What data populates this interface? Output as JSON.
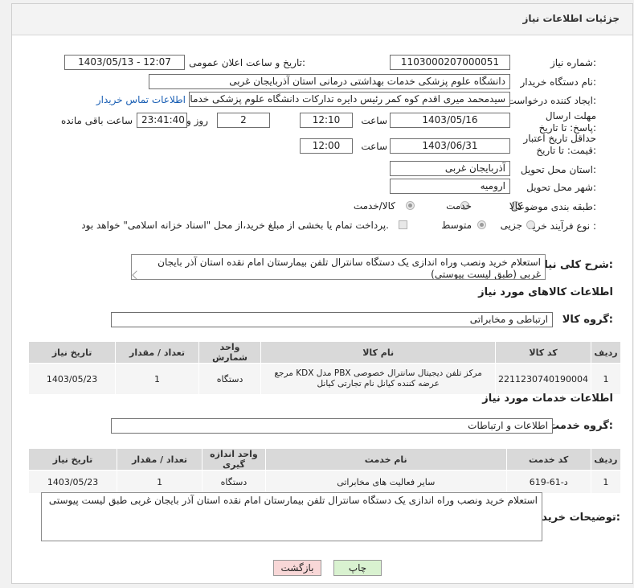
{
  "header": {
    "title": "جزئیات اطلاعات نیاز"
  },
  "form": {
    "need_number_label": "شماره نیاز:",
    "need_number": "1103000207000051",
    "announce_label": "تاریخ و ساعت اعلان عمومی:",
    "announce_value": "1403/05/13 - 12:07",
    "buyer_org_label": "نام دستگاه خریدار:",
    "buyer_org": "دانشگاه علوم پزشکی خدمات بهداشتی درمانی استان آذربایجان غربی",
    "creator_label": "ایجاد کننده درخواست:",
    "creator": "سیدمحمد میری اقدم کوه کمر رئیس دایره تدارکات دانشگاه علوم پزشکی خدمات",
    "contact_link": "اطلاعات تماس خریدار",
    "deadline_label": "مهلت ارسال پاسخ: تا تاریخ:",
    "deadline_date": "1403/05/16",
    "time_label": "ساعت",
    "deadline_time": "12:10",
    "days_value": "2",
    "days_label": "روز و",
    "remaining_time": "23:41:40",
    "remaining_label": "ساعت باقی مانده",
    "validity_label": "حداقل تاریخ اعتبار قیمت: تا تاریخ:",
    "validity_date": "1403/06/31",
    "validity_time": "12:00",
    "province_label": "استان محل تحویل:",
    "province": "آذربایجان غربی",
    "city_label": "شهر محل تحویل:",
    "city": "ارومیه",
    "category_label": "طبقه بندی موضوعی:",
    "category_options": [
      "کالا",
      "خدمت",
      "کالا/خدمت"
    ],
    "category_selected": "کالا/خدمت",
    "process_label": "نوع فرآیند خرید :",
    "process_options": [
      "جزیی",
      "متوسط"
    ],
    "process_note": "پرداخت تمام یا بخشی از مبلغ خرید،از محل \"اسناد خزانه اسلامی\" خواهد بود."
  },
  "description": {
    "label": "شرح کلی نیاز:",
    "text": "استعلام خرید ونصب وراه اندازی  یک دستگاه سانترال تلفن بیمارستان امام نقده استان آذر بایجان غربی (طبق لیست پیوستی)"
  },
  "goods": {
    "section_title": "اطلاعات کالاهای مورد نیاز",
    "group_label": "گروه کالا:",
    "group_value": "ارتباطی و مخابراتی",
    "columns": [
      "ردیف",
      "کد کالا",
      "نام کالا",
      "واحد شمارش",
      "تعداد / مقدار",
      "تاریخ نیاز"
    ],
    "rows": [
      [
        "1",
        "2211230740190004",
        "مرکز تلفن دیجیتال سانترال خصوصی PBX مدل KDX مرجع عرضه کننده کیانل نام تجارتی کیانل",
        "دستگاه",
        "1",
        "1403/05/23"
      ]
    ]
  },
  "services": {
    "section_title": "اطلاعات خدمات مورد نیاز",
    "group_label": "گروه خدمت:",
    "group_value": "اطلاعات و ارتباطات",
    "columns": [
      "ردیف",
      "کد خدمت",
      "نام خدمت",
      "واحد اندازه گیری",
      "تعداد / مقدار",
      "تاریخ نیاز"
    ],
    "rows": [
      [
        "1",
        "د-61-619",
        "سایر فعالیت های مخابراتی",
        "دستگاه",
        "1",
        "1403/05/23"
      ]
    ]
  },
  "buyer_notes": {
    "label": "توضیحات خریدار:",
    "text": "استعلام خرید ونصب وراه اندازی  یک دستگاه سانترال تلفن بیمارستان امام نقده استان آذر بایجان غربی طبق لیست پیوستی"
  },
  "buttons": {
    "print": "چاپ",
    "back": "بازگشت"
  },
  "colors": {
    "back_button": "#f8d7d7",
    "print_button": "#d9f2d0",
    "link": "#1a5fb4"
  }
}
